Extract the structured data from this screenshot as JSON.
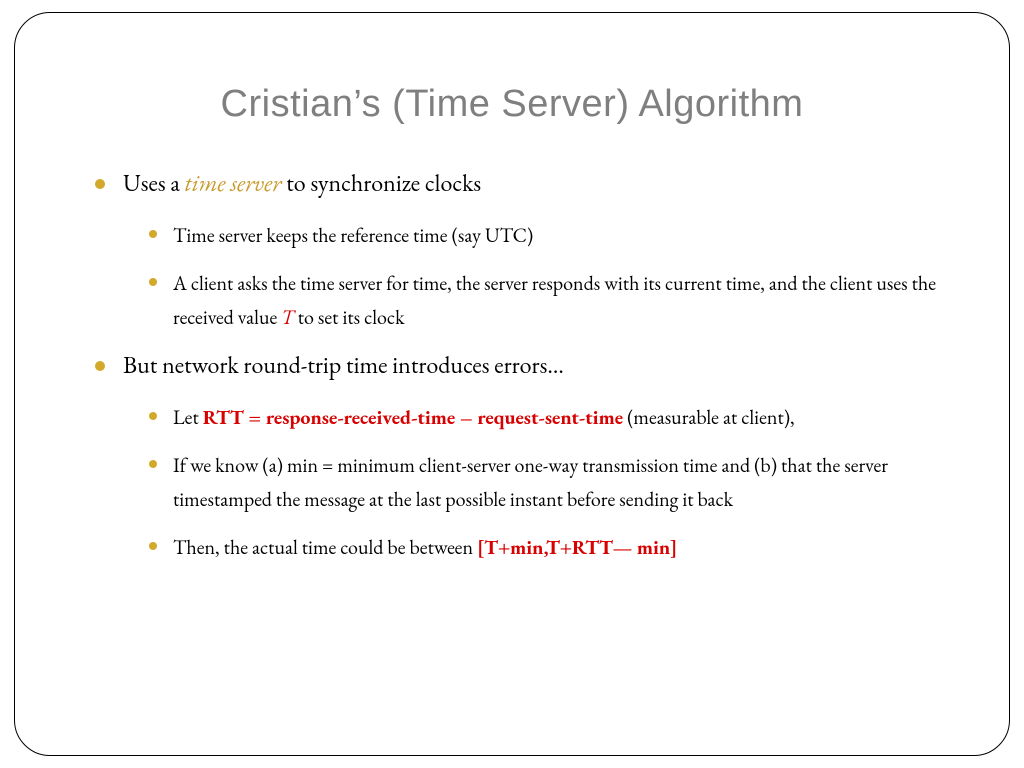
{
  "title": "Cristian’s (Time Server) Algorithm",
  "bullets": {
    "b1": {
      "pre": "Uses a ",
      "highlight": "time server",
      "post": " to synchronize clocks",
      "subs": {
        "s1": "Time server keeps the reference time (say UTC)",
        "s2": {
          "pre": " A client asks the time server for time, the server responds with its current time, and the client uses the received value ",
          "T": "T",
          "post": " to set its clock"
        }
      }
    },
    "b2": {
      "text": "But network round-trip time introduces errors…",
      "subs": {
        "s1": {
          "pre": "Let ",
          "bold": "RTT = response-received-time – request-sent-time",
          "post": " (measurable at client),"
        },
        "s2": "If we know (a) min = minimum client-server one-way transmission time and (b) that the server timestamped the message at the last possible instant before sending it back",
        "s3": {
          "pre": "Then, the actual time could be between ",
          "bold": "[T+min,T+RTT— min]"
        }
      }
    }
  }
}
